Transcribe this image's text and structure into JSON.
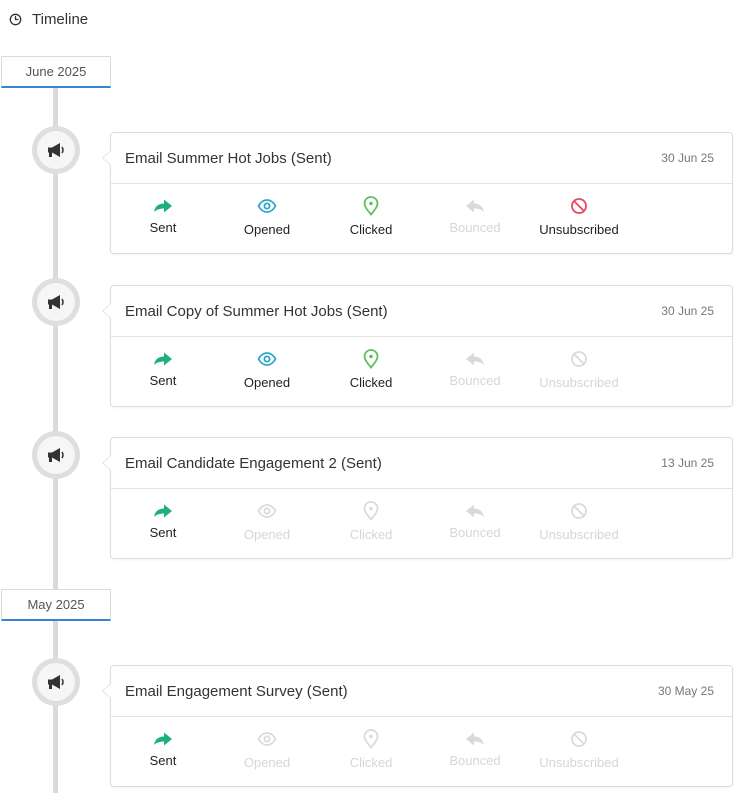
{
  "header": {
    "title": "Timeline",
    "icon": "clock-icon"
  },
  "colors": {
    "sent": "#1fb07a",
    "opened": "#2ba6cb",
    "clicked": "#5ec05e",
    "unsubscribed": "#e8485e",
    "inactive": "#dadada",
    "month_underline": "#3b82d6"
  },
  "months": [
    {
      "label": "June 2025"
    },
    {
      "label": "May 2025"
    }
  ],
  "events": [
    {
      "title": "Email Summer Hot Jobs (Sent)",
      "date": "30 Jun 25",
      "stats": {
        "sent": {
          "label": "Sent",
          "active": true
        },
        "opened": {
          "label": "Opened",
          "active": true
        },
        "clicked": {
          "label": "Clicked",
          "active": true
        },
        "bounced": {
          "label": "Bounced",
          "active": false
        },
        "unsubscribed": {
          "label": "Unsubscribed",
          "active": true
        }
      }
    },
    {
      "title": "Email Copy of Summer Hot Jobs (Sent)",
      "date": "30 Jun 25",
      "stats": {
        "sent": {
          "label": "Sent",
          "active": true
        },
        "opened": {
          "label": "Opened",
          "active": true
        },
        "clicked": {
          "label": "Clicked",
          "active": true
        },
        "bounced": {
          "label": "Bounced",
          "active": false
        },
        "unsubscribed": {
          "label": "Unsubscribed",
          "active": false
        }
      }
    },
    {
      "title": "Email Candidate Engagement 2 (Sent)",
      "date": "13 Jun 25",
      "stats": {
        "sent": {
          "label": "Sent",
          "active": true
        },
        "opened": {
          "label": "Opened",
          "active": false
        },
        "clicked": {
          "label": "Clicked",
          "active": false
        },
        "bounced": {
          "label": "Bounced",
          "active": false
        },
        "unsubscribed": {
          "label": "Unsubscribed",
          "active": false
        }
      }
    },
    {
      "title": "Email Engagement Survey (Sent)",
      "date": "30 May 25",
      "stats": {
        "sent": {
          "label": "Sent",
          "active": true
        },
        "opened": {
          "label": "Opened",
          "active": false
        },
        "clicked": {
          "label": "Clicked",
          "active": false
        },
        "bounced": {
          "label": "Bounced",
          "active": false
        },
        "unsubscribed": {
          "label": "Unsubscribed",
          "active": false
        }
      }
    }
  ]
}
